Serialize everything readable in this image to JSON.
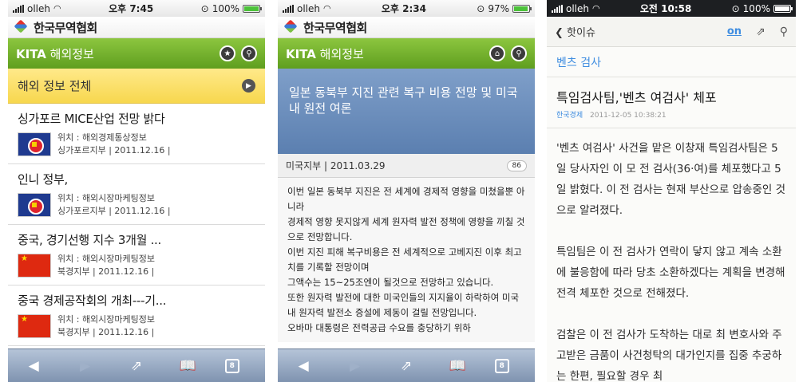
{
  "phone1": {
    "status": {
      "carrier": "olleh",
      "time": "오후 7:45",
      "battery": "100%"
    },
    "logo": "한국무역협회",
    "header": {
      "title_bold": "KITA",
      "title_rest": " 해외정보"
    },
    "all_info": "해외 정보 전체",
    "news": [
      {
        "title": "싱가포르 MICE산업 전망 밝다",
        "location": "위치 : 해외경제통상정보",
        "branch": "싱가포르지부  |  2011.12.16  |"
      },
      {
        "title": "인니 정부,",
        "location": "위치 : 해외시장마케팅정보",
        "branch": "싱가포르지부  |  2011.12.16  |"
      },
      {
        "title": "중국, 경기선행 지수 3개월 ...",
        "location": "위치 : 해외시장마케팅정보",
        "branch": "북경지부  |  2011.12.16  |"
      },
      {
        "title": "중국 경제공작회의 개최---기...",
        "location": "위치 : 해외시장마케팅정보",
        "branch": "북경지부  |  2011.12.16  |"
      }
    ],
    "toolbar": {
      "tabs": "8"
    }
  },
  "phone2": {
    "status": {
      "carrier": "olleh",
      "time": "오후 2:34",
      "battery": "97%"
    },
    "logo": "한국무역협회",
    "header": {
      "title_bold": "KITA",
      "title_rest": " 해외정보"
    },
    "article_title": "일본 동북부 지진 관련 복구 비용 전망 및 미국내 원전 여론",
    "meta": {
      "branch": "미국지부  |  2011.03.29",
      "count": "86"
    },
    "body": [
      "이번 일본 동북부 지진은 전 세계에 경제적 영향을 미쳤을뿐 아니라",
      "경제적 영향 못지않게 세계 원자력 발전 정책에 영향을 끼칠 것으로 전망합니다.",
      "이번 지진 피해 복구비용은 전 세계적으로 고베지진 이후 최고치를 기록할 전망이며",
      "그액수는 15~25조엔이 될것으로 전망하고 있습니다.",
      "또한 원자력 발전에 대한 미국인들의 지지율이 하락하여 미국내 원자력 발전소 증설에 제동이 걸릴 전망입니다.",
      "오바마 대통령은 전력공급 수요를 충당하기 위하"
    ],
    "toolbar": {
      "tabs": "8"
    }
  },
  "phone3": {
    "status": {
      "carrier": "olleh",
      "time": "오전 10:58",
      "battery": "100%"
    },
    "back": "핫이슈",
    "on_label": "on",
    "category": "벤츠 검사",
    "headline": "특임검사팀,'벤츠 여검사' 체포",
    "source": "한국경제",
    "datetime": "2011-12-05 10:38:21",
    "paragraphs": [
      "'벤츠 여검사' 사건을 맡은 이창재 특임검사팀은 5일 당사자인 이 모 전 검사(36·여)를 체포했다고 5일 밝혔다. 이 전 검사는 현재 부산으로 압송중인 것으로 알려졌다.",
      "특임팀은 이 전 검사가 연락이 닿지 않고 계속 소환에 불응함에 따라 당초 소환하겠다는 계획을 변경해 전격 체포한 것으로 전해졌다.",
      "검찰은 이 전 검사가 도착하는 대로 최 변호사와 주고받은 금품이 사건청탁의 대가인지를 집중 추궁하는 한편, 필요할 경우 최"
    ]
  }
}
